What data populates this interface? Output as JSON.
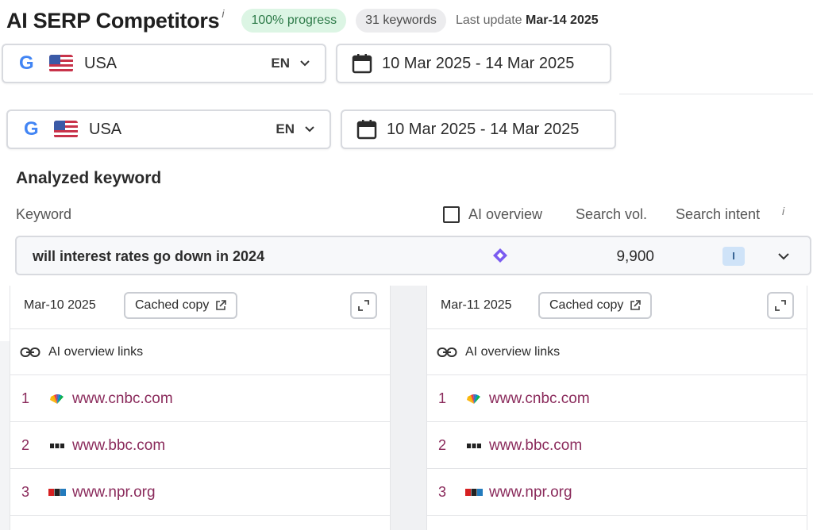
{
  "header": {
    "title": "AI SERP Competitors",
    "title_info": "i",
    "progress": "100% progress",
    "keywords": "31 keywords",
    "last_update_label": "Last update",
    "last_update_value": "Mar-14 2025"
  },
  "filters": {
    "country": "USA",
    "language": "EN",
    "date_range": "10 Mar 2025 - 14 Mar 2025"
  },
  "analyzed": {
    "section_title": "Analyzed keyword",
    "col_keyword": "Keyword",
    "col_ai_overview": "AI overview",
    "col_search_vol": "Search vol.",
    "col_search_intent": "Search intent",
    "intent_info": "i",
    "keyword": "will interest rates go down in 2024",
    "search_volume": "9,900",
    "intent": "I"
  },
  "panels": [
    {
      "date": "Mar-10 2025",
      "cached_label": "Cached copy",
      "links_label": "AI overview links",
      "rows": [
        {
          "rank": "1",
          "domain": "www.cnbc.com",
          "favicon": "cnbc-peacock-icon"
        },
        {
          "rank": "2",
          "domain": "www.bbc.com",
          "favicon": "bbc-blocks-icon"
        },
        {
          "rank": "3",
          "domain": "www.npr.org",
          "favicon": "npr-blocks-icon"
        }
      ]
    },
    {
      "date": "Mar-11 2025",
      "cached_label": "Cached copy",
      "links_label": "AI overview links",
      "rows": [
        {
          "rank": "1",
          "domain": "www.cnbc.com",
          "favicon": "cnbc-peacock-icon"
        },
        {
          "rank": "2",
          "domain": "www.bbc.com",
          "favicon": "bbc-blocks-icon"
        },
        {
          "rank": "3",
          "domain": "www.npr.org",
          "favicon": "npr-blocks-icon"
        }
      ]
    }
  ],
  "colors": {
    "link": "#8a2a5b",
    "progress_bg": "#dcf5e4",
    "progress_text": "#2d7a48",
    "ai_diamond": "#7b5cf0",
    "intent_badge_bg": "#cfe3f8"
  }
}
